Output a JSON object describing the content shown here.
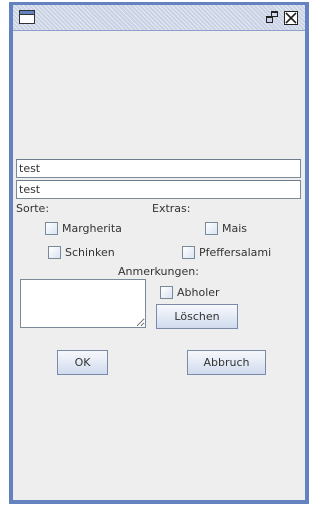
{
  "window": {
    "icons": {
      "app": "app-window-icon",
      "restore": "restore-icon",
      "close": "close-icon"
    }
  },
  "fields": {
    "field1_value": "test",
    "field2_value": "test"
  },
  "labels": {
    "sorte": "Sorte:",
    "extras": "Extras:",
    "anmerkungen": "Anmerkungen:"
  },
  "checkboxes": {
    "margherita": "Margherita",
    "mais": "Mais",
    "schinken": "Schinken",
    "pfeffersalami": "Pfeffersalami",
    "abholer": "Abholer"
  },
  "buttons": {
    "loeschen": "Löschen",
    "ok": "OK",
    "abbruch": "Abbruch"
  },
  "colors": {
    "frame": "#6382bf",
    "panel": "#eeeeee"
  }
}
